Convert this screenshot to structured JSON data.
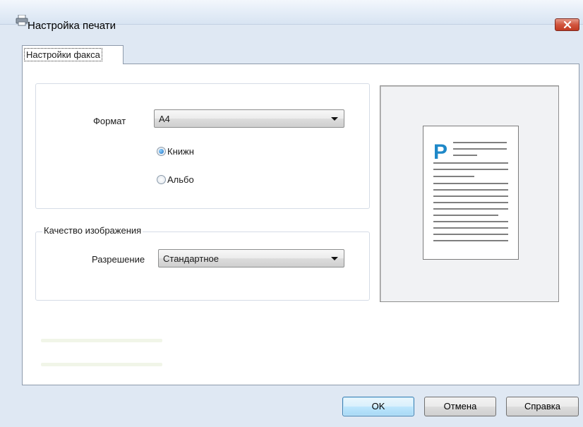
{
  "window": {
    "title": "Настройка печати",
    "icon": "printer-icon",
    "close_icon": "close-icon"
  },
  "tab": {
    "label": "Настройки факса"
  },
  "paper": {
    "format_label": "Формат",
    "format_value": "A4",
    "orientation": {
      "portrait_label": "Книжн",
      "landscape_label": "Альбо",
      "selected": "portrait"
    }
  },
  "quality": {
    "group_label": "Качество изображения",
    "resolution_label": "Разрешение",
    "resolution_value": "Стандартное"
  },
  "preview": {
    "page_letter": "P"
  },
  "buttons": {
    "ok": "OK",
    "cancel": "Отмена",
    "help": "Справка"
  },
  "colors": {
    "accent": "#1f6fc4",
    "preview_letter": "#1e88c8",
    "close": "#c9432b"
  }
}
